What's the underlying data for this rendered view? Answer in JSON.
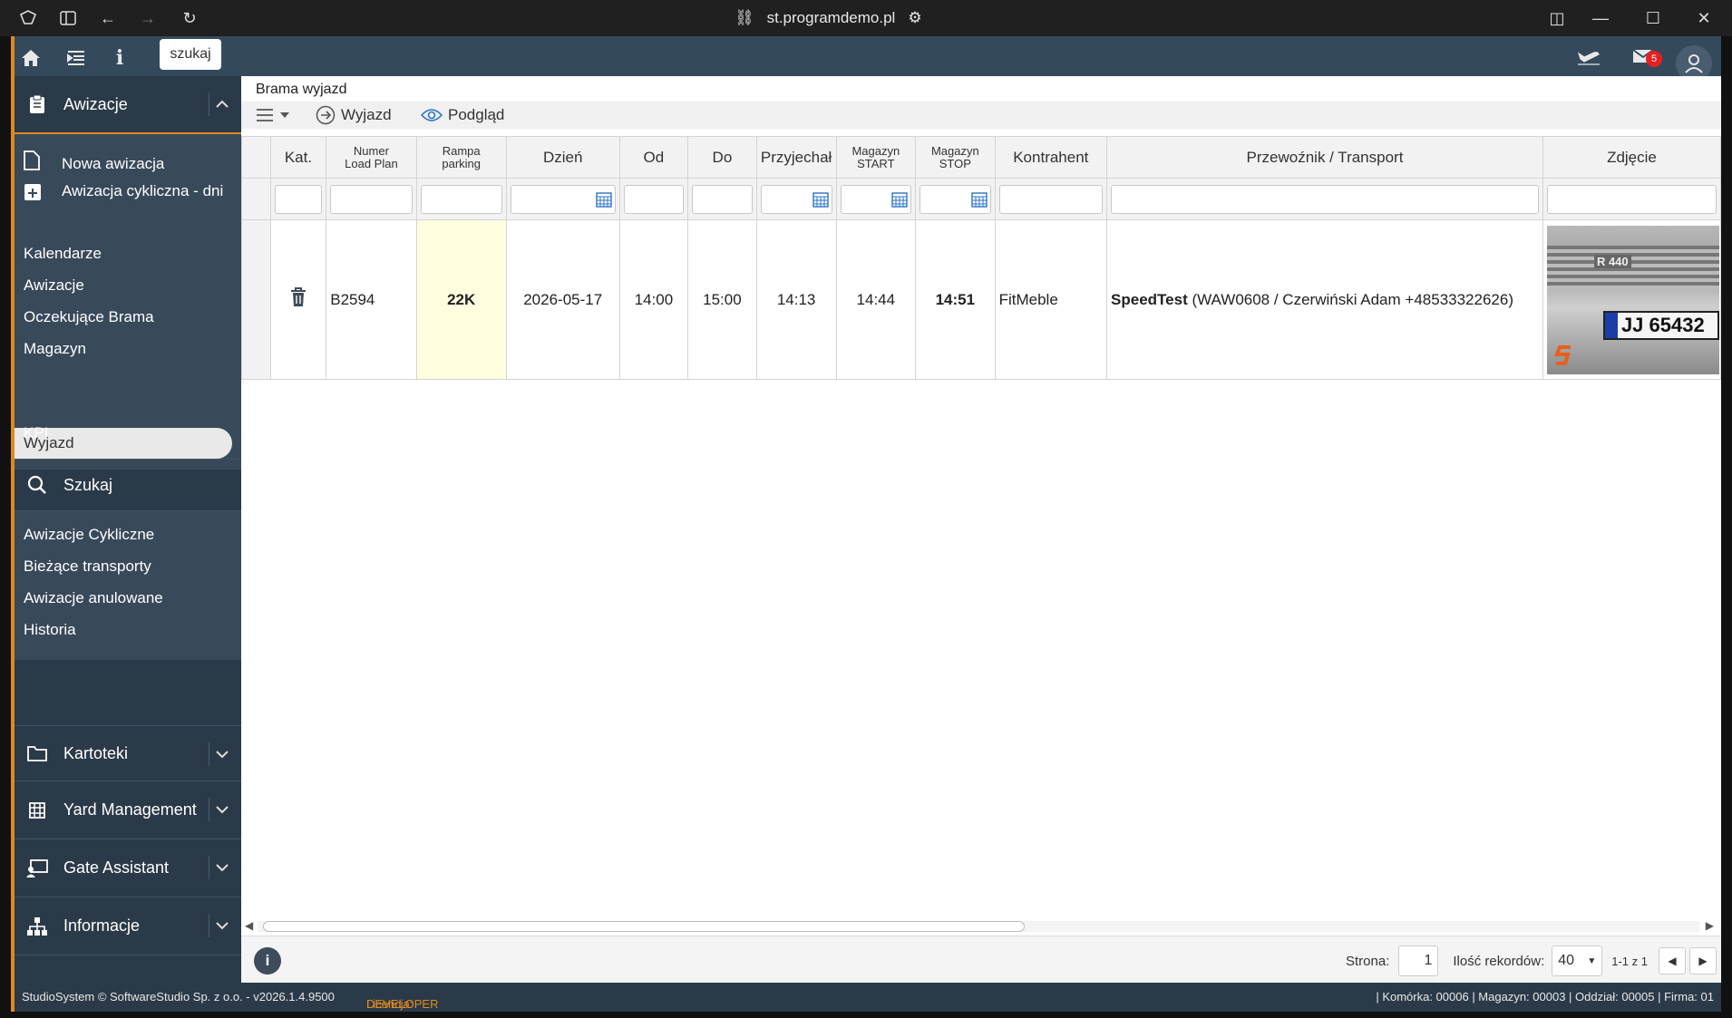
{
  "browser": {
    "url": "st.programdemo.pl"
  },
  "header": {
    "search_label": "szukaj",
    "mail_count": "5"
  },
  "sidebar": {
    "awizacje_label": "Awizacje",
    "nowa": "Nowa awizacja",
    "cykliczna": "Awizacja cykliczna - dni",
    "kalendarze": "Kalendarze",
    "awizacje": "Awizacje",
    "oczekujace": "Oczekujące Brama",
    "magazyn": "Magazyn",
    "wyjazd": "Wyjazd",
    "kpi": "KPI",
    "szukaj": "Szukaj",
    "cykliczne": "Awizacje Cykliczne",
    "biezace": "Bieżące transporty",
    "anulowane": "Awizacje anulowane",
    "historia": "Historia",
    "kartoteki": "Kartoteki",
    "yard": "Yard Management",
    "gate": "Gate Assistant",
    "informacje": "Informacje"
  },
  "main": {
    "title": "Brama wyjazd",
    "toolbar": {
      "wyjazd": "Wyjazd",
      "podglad": "Podgląd"
    },
    "columns": {
      "kat": "Kat.",
      "numer_1": "Numer",
      "numer_2": "Load Plan",
      "rampa_1": "Rampa",
      "rampa_2": "parking",
      "dzien": "Dzień",
      "od": "Od",
      "do": "Do",
      "przyjechal": "Przyjechał",
      "mag_start_1": "Magazyn",
      "mag_start_2": "START",
      "mag_stop_1": "Magazyn",
      "mag_stop_2": "STOP",
      "kontrahent": "Kontrahent",
      "przewoznik": "Przewoźnik / Transport",
      "zdjecie": "Zdjęcie"
    },
    "row": {
      "numer": "B2594",
      "rampa": "22K",
      "dzien": "2026-05-17",
      "od": "14:00",
      "do": "15:00",
      "przyjechal": "14:13",
      "mag_start": "14:44",
      "mag_stop": "14:51",
      "kontrahent": "FitMeble",
      "przewoznik_name": "SpeedTest",
      "przewoznik_detail": "(WAW0608 / Czerwiński Adam +48533322626)",
      "plate": "JJ 65432",
      "truck_model": "R 440"
    },
    "pager": {
      "strona_label": "Strona:",
      "strona_value": "1",
      "ilosc_label": "Ilość rekordów:",
      "ilosc_value": "40",
      "range": "1-1 z 1"
    }
  },
  "statusbar": {
    "copyright": "StudioSystem © SoftwareStudio Sp. z o.o. - v2026.1.4.9500",
    "license_label": "Licencja:",
    "license_value": "DEVELOPER",
    "right": "| Komórka: 00006 | Magazyn: 00003 | Oddział: 00005 | Firma: 01"
  },
  "colors": {
    "accent": "#e08a1e",
    "sidebar": "#2b3a48",
    "badge": "#e62020",
    "link_icon": "#2c73c6"
  }
}
